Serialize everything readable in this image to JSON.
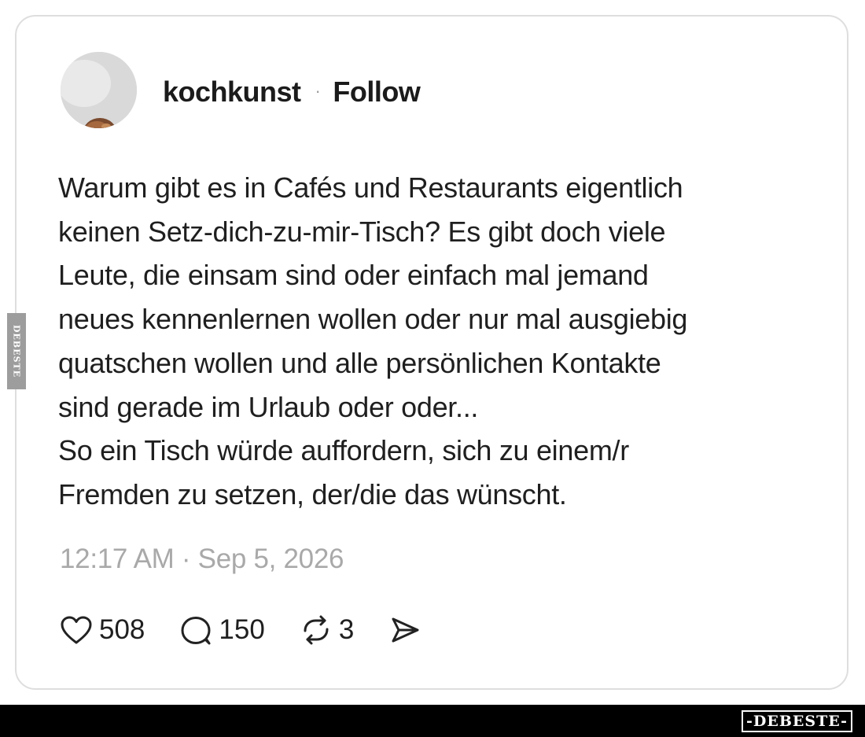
{
  "post": {
    "username": "kochkunst",
    "separator": "·",
    "follow_label": "Follow",
    "text": "Warum gibt es in Cafés und Restaurants eigentlich\nkeinen Setz-dich-zu-mir-Tisch? Es gibt doch viele\nLeute, die einsam sind oder einfach mal jemand\nneues kennenlernen wollen oder nur mal ausgiebig\nquatschen wollen und alle persönlichen Kontakte\nsind gerade im Urlaub oder oder...\nSo ein Tisch würde auffordern, sich zu einem/r\nFremden zu setzen, der/die das wünscht.",
    "timestamp": "12:17 AM · Sep 5, 2026"
  },
  "actions": {
    "likes": "508",
    "replies": "150",
    "reposts": "3"
  },
  "icons": {
    "like": "heart-icon",
    "reply": "speech-bubble-icon",
    "repost": "repost-icon",
    "share": "send-icon"
  },
  "watermark": {
    "side_label": "DEBESTE",
    "footer_label": "-DEBESTE-"
  },
  "colors": {
    "text": "#1f1f1f",
    "muted": "#a9a9a9",
    "border": "#dedede",
    "footer": "#000000"
  }
}
